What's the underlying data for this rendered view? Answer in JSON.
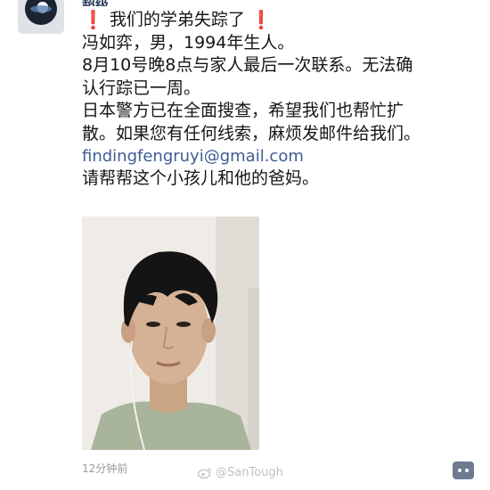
{
  "post": {
    "username": "超级",
    "title_text": "我们的学弟失踪了",
    "lines": [
      "冯如弈，男，1994年生人。",
      "8月10号晚8点与家人最后一次联系。无法确",
      "认行踪已一周。",
      "日本警方已在全面搜查，希望我们也帮忙扩",
      "散。如果您有任何线索，麻烦发邮件给我们。"
    ],
    "email": "findingfengruyi@gmail.com",
    "closing": "请帮帮这个小孩儿和他的爸妈。",
    "timestamp": "12分钟前"
  },
  "icons": {
    "exclamation": "heavy-exclamation-mark-icon",
    "comment": "comment-icon",
    "weibo": "weibo-logo-icon"
  },
  "watermark": "@SanTough",
  "colors": {
    "exclamation": "#e1271b",
    "link": "#3f5c93",
    "timestamp": "#9a9a9a"
  }
}
